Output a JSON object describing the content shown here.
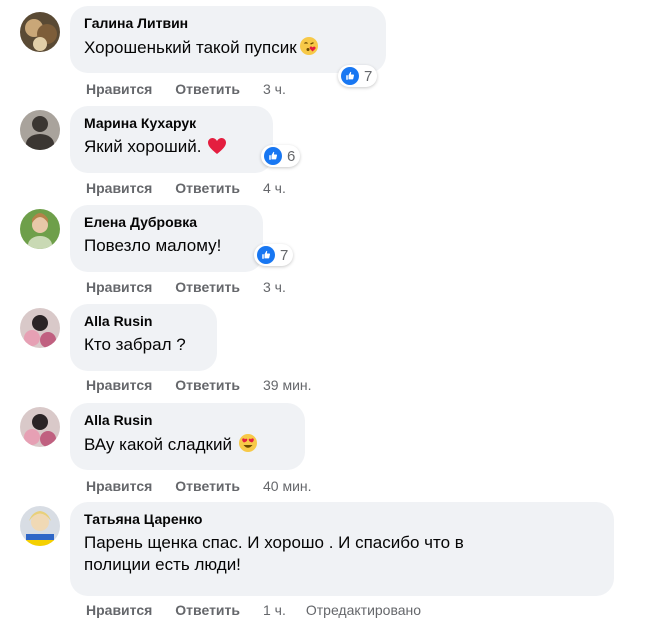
{
  "colors": {
    "bubble_bg": "#f0f2f5",
    "like_blue": "#1877f2",
    "secondary_text": "#65676b",
    "heart_red": "#e41e3f"
  },
  "actions": {
    "like_label": "Нравится",
    "reply_label": "Ответить"
  },
  "comments": [
    {
      "author": "Галина Литвин",
      "text": "Хорошенький такой пупсик",
      "emoji": "kissing-face-emoji",
      "reaction_icon": "like-icon",
      "reaction_count": "7",
      "time": "3 ч."
    },
    {
      "author": "Марина Кухарук",
      "text": "Який хороший.",
      "emoji": "red-heart-emoji",
      "reaction_icon": "like-icon",
      "reaction_count": "6",
      "time": "4 ч."
    },
    {
      "author": "Елена Дубровка",
      "text": "Повезло малому!",
      "reaction_icon": "like-icon",
      "reaction_count": "7",
      "time": "3 ч."
    },
    {
      "author": "Alla Rusin",
      "text": "Кто забрал ?",
      "time": "39 мин."
    },
    {
      "author": "Alla Rusin",
      "text": "ВАу какой сладкий",
      "emoji": "heart-eyes-emoji",
      "time": "40 мин."
    },
    {
      "author": "Татьяна Царенко",
      "text_line1": "Парень щенка спас. И хорошо . И спасибо что в",
      "text_line2": "полиции есть люди!",
      "time": "1 ч.",
      "edited_label": "Отредактировано"
    }
  ]
}
